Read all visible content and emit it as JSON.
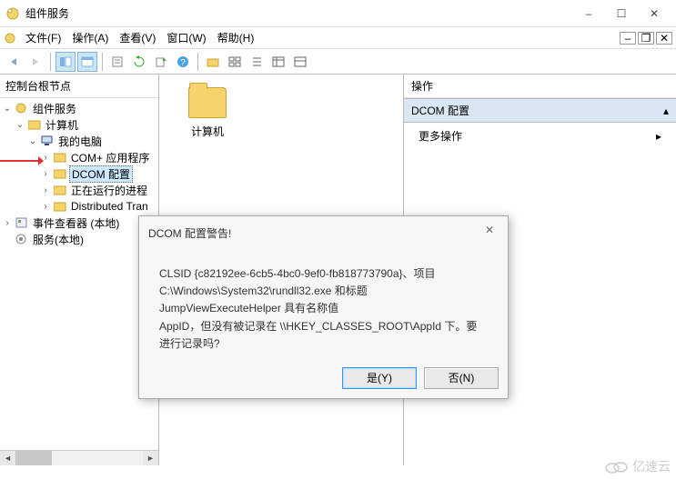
{
  "window": {
    "title": "组件服务",
    "minimize": "–",
    "maximize": "☐",
    "close": "✕"
  },
  "menu": {
    "file": "文件(F)",
    "action": "操作(A)",
    "view": "查看(V)",
    "window": "窗口(W)",
    "help": "帮助(H)"
  },
  "tree": {
    "root": "控制台根节点",
    "nodes": {
      "component_services": "组件服务",
      "computers": "计算机",
      "my_computer": "我的电脑",
      "com_apps": "COM+ 应用程序",
      "dcom_config": "DCOM 配置",
      "running_processes": "正在运行的进程",
      "distributed_tran": "Distributed Tran",
      "event_viewer": "事件查看器 (本地)",
      "services": "服务(本地)"
    }
  },
  "content": {
    "item_label": "计算机"
  },
  "actions": {
    "header": "操作",
    "section": "DCOM 配置",
    "more": "更多操作"
  },
  "dialog": {
    "title": "DCOM 配置警告!",
    "line1": "CLSID {c82192ee-6cb5-4bc0-9ef0-fb818773790a}、项目",
    "line2": "C:\\Windows\\System32\\rundll32.exe 和标题 JumpViewExecuteHelper 具有名称值",
    "line3": "AppID，但没有被记录在 \\\\HKEY_CLASSES_ROOT\\AppId 下。要进行记录吗?",
    "yes": "是(Y)",
    "no": "否(N)"
  },
  "watermark": "亿速云"
}
